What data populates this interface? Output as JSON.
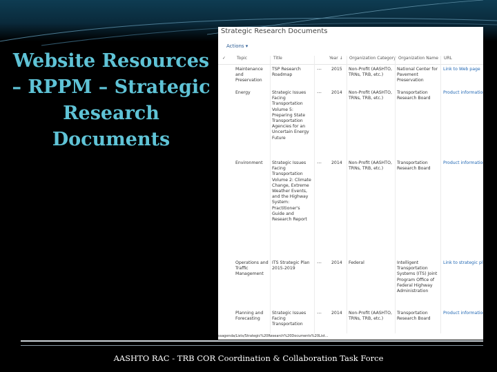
{
  "slide": {
    "title_lines": [
      "Website Resources",
      "– RPPM – Strategic",
      "Research",
      "Documents"
    ],
    "footer": "AASHTO RAC - TRB COR Coordination & Collaboration Task Force"
  },
  "screenshot": {
    "title": "Strategic Research Documents",
    "actions_label": "Actions ▾",
    "columns": [
      "Topic",
      "Title",
      "Year ↓",
      "Organization Category",
      "Organization Name",
      "URL"
    ],
    "rows": [
      {
        "topic": "Maintenance and Preservation",
        "title": "TSP Research Roadmap",
        "year": "2015",
        "category": "Non-Profit (AASHTO, TRNs, TRB, etc.)",
        "org": "National Center for Pavement Preservation",
        "url": "Link to Web page"
      },
      {
        "topic": "Energy",
        "title": "Strategic Issues Facing Transportation Volume 5: Preparing State Transportation Agencies for an Uncertain Energy Future",
        "year": "2014",
        "category": "Non-Profit (AASHTO, TRNs, TRB, etc.)",
        "org": "Transportation Research Board",
        "url": "Product information"
      },
      {
        "topic": "Environment",
        "title": "Strategic Issues Facing Transportation Volume 2: Climate Change, Extreme Weather Events, and the Highway System: Practitioner's Guide and Research Report",
        "year": "2014",
        "category": "Non-Profit (AASHTO, TRNs, TRB, etc.)",
        "org": "Transportation Research Board",
        "url": "Product information"
      },
      {
        "topic": "Operations and Traffic Management",
        "title": "ITS Strategic Plan 2015-2019",
        "year": "2014",
        "category": "Federal",
        "org": "Intelligent Transportation Systems (ITS) Joint Program Office of Federal Highway Administration",
        "url": "Link to strategic plan"
      },
      {
        "topic": "Planning and Forecasting",
        "title": "Strategic Issues Facing Transportation",
        "year": "2014",
        "category": "Non-Profit (AASHTO, TRNs, TRB, etc.)",
        "org": "Transportation Research Board",
        "url": "Product information"
      }
    ],
    "url_text": "ssagenda/Lists/Strategic%20Research%20Documents%20List..."
  }
}
